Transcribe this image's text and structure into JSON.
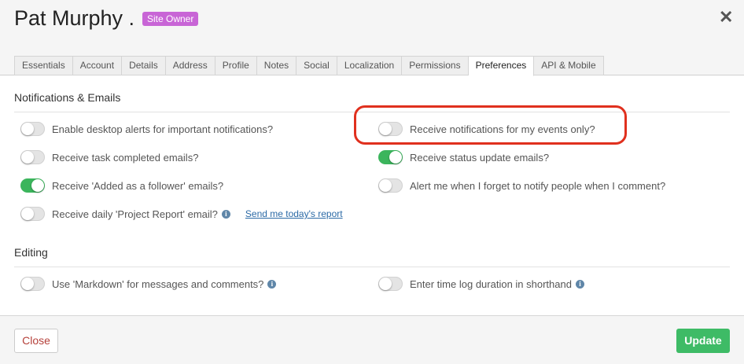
{
  "header": {
    "title": "Pat Murphy .",
    "badge": "Site Owner"
  },
  "tabs": [
    {
      "label": "Essentials"
    },
    {
      "label": "Account"
    },
    {
      "label": "Details"
    },
    {
      "label": "Address"
    },
    {
      "label": "Profile"
    },
    {
      "label": "Notes"
    },
    {
      "label": "Social"
    },
    {
      "label": "Localization"
    },
    {
      "label": "Permissions"
    },
    {
      "label": "Preferences",
      "active": true
    },
    {
      "label": "API & Mobile"
    }
  ],
  "notifications": {
    "title": "Notifications & Emails",
    "options": [
      {
        "label": "Enable desktop alerts for important notifications?",
        "on": false
      },
      {
        "label": "Receive notifications for my events only?",
        "on": false
      },
      {
        "label": "Receive task completed emails?",
        "on": false
      },
      {
        "label": "Receive status update emails?",
        "on": true
      },
      {
        "label": "Receive 'Added as a follower' emails?",
        "on": true
      },
      {
        "label": "Alert me when I forget to notify people when I comment?",
        "on": false
      },
      {
        "label": "Receive daily 'Project Report' email?",
        "on": false
      }
    ],
    "report_link": "Send me today's report"
  },
  "editing": {
    "title": "Editing",
    "options": [
      {
        "label": "Use 'Markdown' for messages and comments?",
        "on": false
      },
      {
        "label": "Enter time log duration in shorthand",
        "on": false
      }
    ]
  },
  "footer": {
    "close_label": "Close",
    "update_label": "Update"
  },
  "icons": {
    "close": "close-x-icon",
    "info": "info-icon"
  },
  "colors": {
    "badge": "#c865d6",
    "toggle_on": "#3bb55c",
    "update_button": "#3ebb66",
    "highlight": "#e0301e",
    "link": "#2b6aa6"
  }
}
